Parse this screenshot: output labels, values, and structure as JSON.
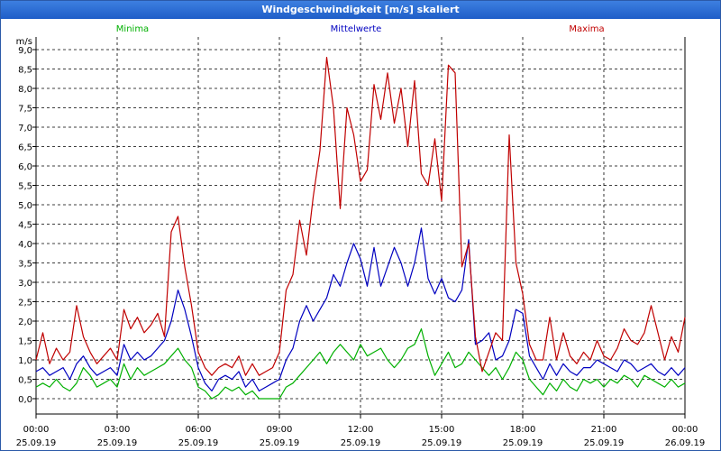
{
  "window": {
    "title": "Windgeschwindigkeit [m/s] skaliert"
  },
  "chart_data": {
    "type": "line",
    "title": "Windgeschwindigkeit [m/s] skaliert",
    "ylabel": "m/s",
    "ylim": [
      -0.5,
      9.0
    ],
    "yticks": [
      0.0,
      0.5,
      1.0,
      1.5,
      2.0,
      2.5,
      3.0,
      3.5,
      4.0,
      4.5,
      5.0,
      5.5,
      6.0,
      6.5,
      7.0,
      7.5,
      8.0,
      8.5,
      9.0
    ],
    "ytick_labels": [
      "0,0",
      "0,5",
      "1,0",
      "1,5",
      "2,0",
      "2,5",
      "3,0",
      "3,5",
      "4,0",
      "4,5",
      "5,0",
      "5,5",
      "6,0",
      "6,5",
      "7,0",
      "7,5",
      "8,0",
      "8,5",
      "9,0"
    ],
    "xlim": [
      "2019-09-25 00:00",
      "2019-09-26 00:00"
    ],
    "xticks": [
      {
        "time": "00:00",
        "date": "25.09.19"
      },
      {
        "time": "03:00",
        "date": "25.09.19"
      },
      {
        "time": "06:00",
        "date": "25.09.19"
      },
      {
        "time": "09:00",
        "date": "25.09.19"
      },
      {
        "time": "12:00",
        "date": "25.09.19"
      },
      {
        "time": "15:00",
        "date": "25.09.19"
      },
      {
        "time": "18:00",
        "date": "25.09.19"
      },
      {
        "time": "21:00",
        "date": "25.09.19"
      },
      {
        "time": "00:00",
        "date": "26.09.19"
      }
    ],
    "grid": true,
    "legend_position": "top",
    "x_hours": [
      0,
      0.25,
      0.5,
      0.75,
      1,
      1.25,
      1.5,
      1.75,
      2,
      2.25,
      2.5,
      2.75,
      3,
      3.25,
      3.5,
      3.75,
      4,
      4.25,
      4.5,
      4.75,
      5,
      5.25,
      5.5,
      5.75,
      6,
      6.25,
      6.5,
      6.75,
      7,
      7.25,
      7.5,
      7.75,
      8,
      8.25,
      8.5,
      8.75,
      9,
      9.25,
      9.5,
      9.75,
      10,
      10.25,
      10.5,
      10.75,
      11,
      11.25,
      11.5,
      11.75,
      12,
      12.25,
      12.5,
      12.75,
      13,
      13.25,
      13.5,
      13.75,
      14,
      14.25,
      14.5,
      14.75,
      15,
      15.25,
      15.5,
      15.75,
      16,
      16.25,
      16.5,
      16.75,
      17,
      17.25,
      17.5,
      17.75,
      18,
      18.25,
      18.5,
      18.75,
      19,
      19.25,
      19.5,
      19.75,
      20,
      20.25,
      20.5,
      20.75,
      21,
      21.25,
      21.5,
      21.75,
      22,
      22.25,
      22.5,
      22.75,
      23,
      23.25,
      23.5,
      23.75,
      24
    ],
    "series": [
      {
        "name": "Minima",
        "color": "#00b000",
        "values": [
          0.3,
          0.4,
          0.3,
          0.5,
          0.3,
          0.2,
          0.4,
          0.8,
          0.6,
          0.3,
          0.4,
          0.5,
          0.3,
          0.9,
          0.5,
          0.8,
          0.6,
          0.7,
          0.8,
          0.9,
          1.1,
          1.3,
          1.0,
          0.8,
          0.3,
          0.2,
          0.0,
          0.1,
          0.3,
          0.2,
          0.3,
          0.1,
          0.2,
          0.0,
          0.0,
          0.0,
          0.0,
          0.3,
          0.4,
          0.6,
          0.8,
          1.0,
          1.2,
          0.9,
          1.2,
          1.4,
          1.2,
          1.0,
          1.4,
          1.1,
          1.2,
          1.3,
          1.0,
          0.8,
          1.0,
          1.3,
          1.4,
          1.8,
          1.1,
          0.6,
          0.9,
          1.2,
          0.8,
          0.9,
          1.2,
          1.0,
          0.8,
          0.6,
          0.8,
          0.5,
          0.8,
          1.2,
          1.0,
          0.5,
          0.3,
          0.1,
          0.4,
          0.2,
          0.5,
          0.3,
          0.2,
          0.5,
          0.4,
          0.5,
          0.3,
          0.5,
          0.4,
          0.6,
          0.5,
          0.3,
          0.6,
          0.5,
          0.4,
          0.3,
          0.5,
          0.3,
          0.4
        ]
      },
      {
        "name": "Mittelwerte",
        "color": "#0000c0",
        "values": [
          0.7,
          0.8,
          0.6,
          0.7,
          0.8,
          0.5,
          0.9,
          1.1,
          0.8,
          0.6,
          0.7,
          0.8,
          0.6,
          1.4,
          1.0,
          1.2,
          1.0,
          1.1,
          1.3,
          1.5,
          2.0,
          2.8,
          2.3,
          1.6,
          0.8,
          0.4,
          0.2,
          0.5,
          0.6,
          0.5,
          0.7,
          0.3,
          0.5,
          0.2,
          0.3,
          0.4,
          0.5,
          1.0,
          1.3,
          2.0,
          2.4,
          2.0,
          2.3,
          2.6,
          3.2,
          2.9,
          3.5,
          4.0,
          3.6,
          2.9,
          3.9,
          2.9,
          3.4,
          3.9,
          3.5,
          2.9,
          3.5,
          4.4,
          3.1,
          2.7,
          3.1,
          2.6,
          2.5,
          2.8,
          4.1,
          1.4,
          1.5,
          1.7,
          1.0,
          1.1,
          1.5,
          2.3,
          2.2,
          1.1,
          0.8,
          0.5,
          0.9,
          0.6,
          0.9,
          0.7,
          0.6,
          0.8,
          0.8,
          1.0,
          0.9,
          0.8,
          0.7,
          1.0,
          0.9,
          0.7,
          0.8,
          0.9,
          0.7,
          0.6,
          0.8,
          0.6,
          0.8
        ]
      },
      {
        "name": "Maxima",
        "color": "#c00000",
        "values": [
          1.0,
          1.7,
          0.9,
          1.3,
          1.0,
          1.2,
          2.4,
          1.6,
          1.2,
          0.9,
          1.1,
          1.3,
          1.0,
          2.3,
          1.8,
          2.1,
          1.7,
          1.9,
          2.2,
          1.6,
          4.3,
          4.7,
          3.4,
          2.4,
          1.2,
          0.8,
          0.6,
          0.8,
          0.9,
          0.8,
          1.1,
          0.6,
          0.9,
          0.6,
          0.7,
          0.8,
          1.2,
          2.8,
          3.2,
          4.6,
          3.7,
          5.2,
          6.4,
          8.8,
          7.5,
          4.9,
          7.5,
          6.8,
          5.6,
          5.9,
          8.1,
          7.2,
          8.4,
          7.1,
          8.0,
          6.5,
          8.2,
          5.8,
          5.5,
          6.7,
          5.1,
          8.6,
          8.4,
          3.4,
          4.0,
          1.6,
          0.7,
          1.2,
          1.7,
          1.5,
          6.8,
          3.5,
          2.7,
          1.4,
          1.0,
          1.0,
          2.1,
          1.0,
          1.7,
          1.1,
          0.9,
          1.2,
          1.0,
          1.5,
          1.1,
          1.0,
          1.3,
          1.8,
          1.5,
          1.4,
          1.7,
          2.4,
          1.7,
          1.0,
          1.6,
          1.2,
          2.1
        ]
      }
    ]
  }
}
